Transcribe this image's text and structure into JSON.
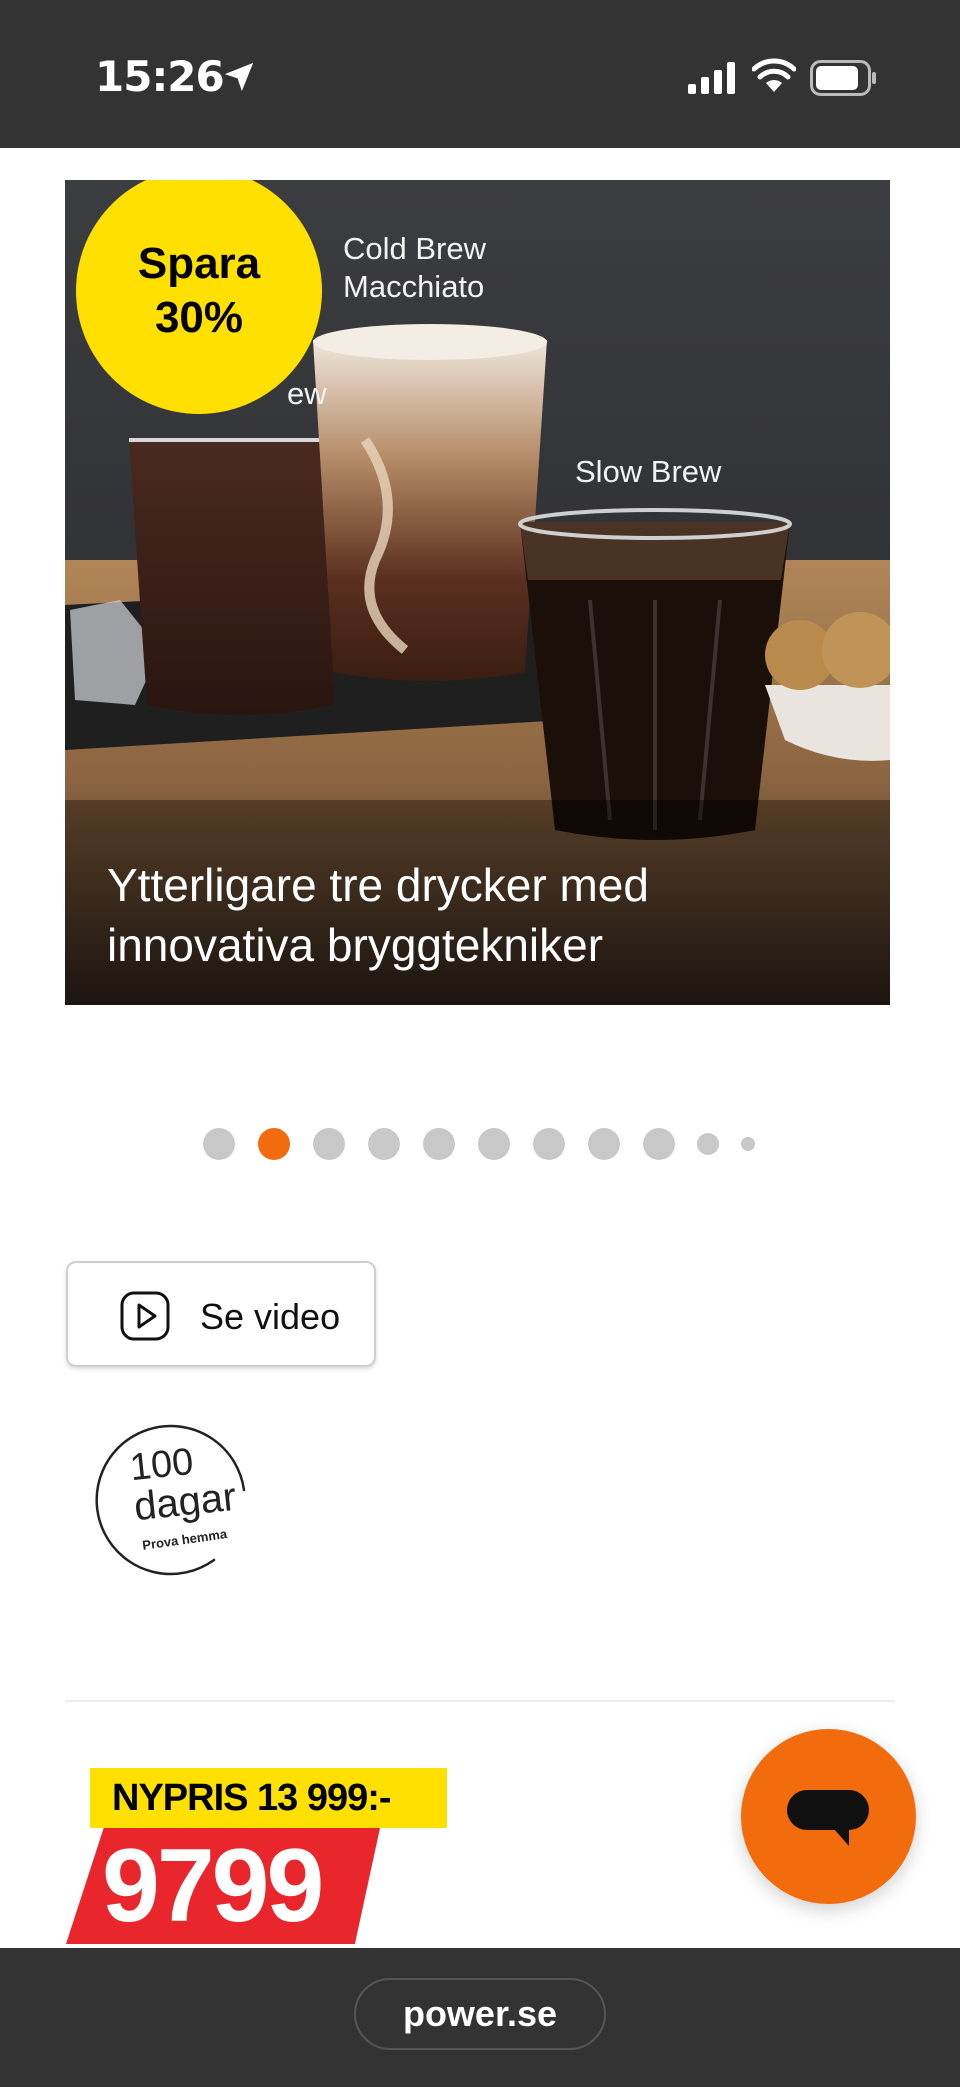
{
  "status_bar": {
    "time": "15:26"
  },
  "hero": {
    "badge_line1": "Spara",
    "badge_line2": "30%",
    "label_cold_brew_macchiato": "Cold Brew\nMacchiato",
    "label_partial_brew": "ew",
    "label_slow_brew": "Slow Brew",
    "caption": "Ytterligare tre drycker med innovativa bryggtekniker"
  },
  "carousel": {
    "total_dots": 11,
    "active_index": 1,
    "active_color": "#f26c0d",
    "inactive_color": "#c8c8c8"
  },
  "video_button": {
    "label": "Se video",
    "icon": "play-icon"
  },
  "trial_badge": {
    "number": "100",
    "unit": "dagar",
    "subtitle": "Prova hemma"
  },
  "price": {
    "old_price_label": "NYPRIS 13 999:-",
    "current_price": "9799"
  },
  "chat": {
    "icon": "chat-bubble-icon"
  },
  "browser": {
    "domain": "power.se"
  },
  "colors": {
    "accent_orange": "#f26c0d",
    "badge_yellow": "#ffe000",
    "price_red": "#e8262c",
    "bars": "#333333"
  }
}
